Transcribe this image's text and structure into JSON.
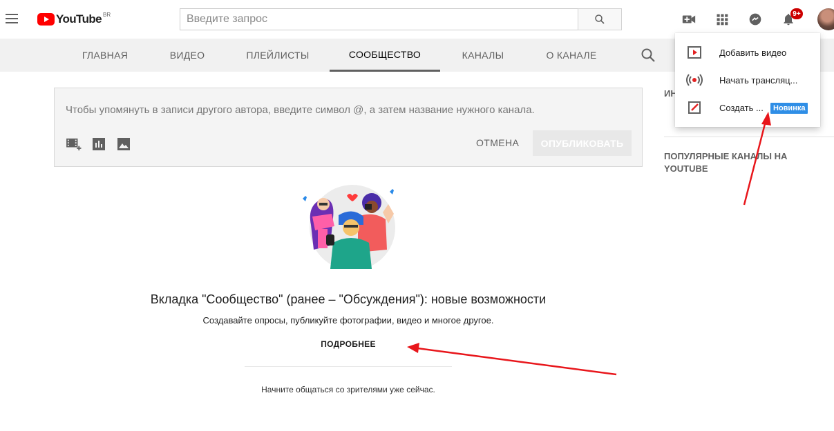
{
  "header": {
    "logo_text": "YouTube",
    "country_code": "BR",
    "search_placeholder": "Введите запрос",
    "notification_count": "9+",
    "icons": [
      "menu-icon",
      "create-video-icon",
      "apps-icon",
      "messages-icon",
      "notifications-icon"
    ]
  },
  "tabs": [
    {
      "label": "Главная",
      "active": false
    },
    {
      "label": "Видео",
      "active": false
    },
    {
      "label": "Плейлисты",
      "active": false
    },
    {
      "label": "Сообщество",
      "active": true
    },
    {
      "label": "Каналы",
      "active": false
    },
    {
      "label": "О канале",
      "active": false
    }
  ],
  "composer": {
    "placeholder": "Чтобы упомянуть в записи другого автора, введите символ @, а затем название нужного канала.",
    "cancel_label": "ОТМЕНА",
    "publish_label": "ОПУБЛИКОВАТЬ"
  },
  "promo": {
    "headline": "Вкладка \"Сообщество\" (ранее – \"Обсуждения\"): новые возможности",
    "subline": "Создавайте опросы, публикуйте фотографии, видео и многое другое.",
    "more_label": "ПОДРОБНЕЕ",
    "start_note": "Начните общаться со зрителями уже сейчас."
  },
  "sidebar": {
    "title1": "ИН",
    "title2": "ПОПУЛЯРНЫЕ КАНАЛЫ НА YOUTUBE"
  },
  "create_menu": {
    "items": [
      {
        "label": "Добавить видео",
        "icon": "upload-video-icon"
      },
      {
        "label": "Начать трансляц...",
        "icon": "live-broadcast-icon"
      },
      {
        "label": "Создать ...",
        "icon": "create-post-icon",
        "badge": "Новинка"
      }
    ]
  },
  "colors": {
    "brand_red": "#ff0000",
    "annotation_red": "#e8161b",
    "badge_blue": "#2f8ee6"
  }
}
